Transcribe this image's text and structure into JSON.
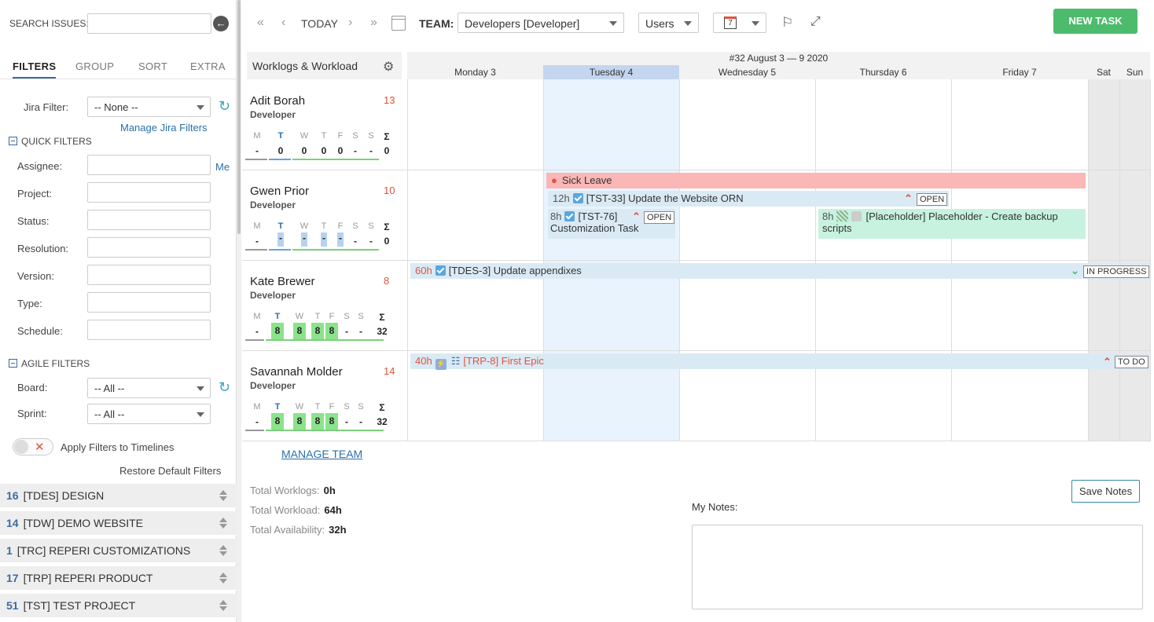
{
  "sidebar": {
    "search_label": "SEARCH ISSUES:",
    "tabs": [
      "FILTERS",
      "GROUP",
      "SORT",
      "EXTRA"
    ],
    "jira_filter_label": "Jira Filter:",
    "jira_filter_value": "-- None --",
    "manage_jira_filters": "Manage Jira Filters",
    "quick_filters_title": "QUICK FILTERS",
    "quick_filters": [
      "Assignee:",
      "Project:",
      "Status:",
      "Resolution:",
      "Version:",
      "Type:",
      "Schedule:"
    ],
    "me_link": "Me",
    "agile_filters_title": "AGILE FILTERS",
    "board_label": "Board:",
    "board_value": "-- All --",
    "sprint_label": "Sprint:",
    "sprint_value": "-- All --",
    "apply_filters_label": "Apply Filters to Timelines",
    "restore_defaults": "Restore Default Filters",
    "projects": [
      {
        "count": "16",
        "name": "[TDES] DESIGN"
      },
      {
        "count": "14",
        "name": "[TDW] DEMO WEBSITE"
      },
      {
        "count": "1",
        "name": "[TRC] REPERI CUSTOMIZATIONS"
      },
      {
        "count": "17",
        "name": "[TRP] REPERI PRODUCT"
      },
      {
        "count": "51",
        "name": "[TST] TEST PROJECT"
      }
    ]
  },
  "toolbar": {
    "today": "TODAY",
    "team_label": "TEAM:",
    "team_value": "Developers [Developer]",
    "users_value": "Users",
    "calendar_day": "7",
    "new_task": "NEW TASK"
  },
  "grid": {
    "panel_title": "Worklogs & Workload",
    "week_title": "#32 August 3 — 9 2020",
    "days": [
      "Monday 3",
      "Tuesday 4",
      "Wednesday 5",
      "Thursday 6",
      "Friday 7",
      "Sat",
      "Sun"
    ],
    "week_letters": [
      "M",
      "T",
      "W",
      "T",
      "F",
      "S",
      "S",
      "Σ"
    ],
    "users": [
      {
        "name": "Adit Borah",
        "role": "Developer",
        "count": "13",
        "values": [
          "-",
          "0",
          "0",
          "0",
          "0",
          "-",
          "-",
          "0"
        ]
      },
      {
        "name": "Gwen Prior",
        "role": "Developer",
        "count": "10",
        "values": [
          "-",
          "-",
          "-",
          "-",
          "-",
          "-",
          "-",
          "0"
        ]
      },
      {
        "name": "Kate Brewer",
        "role": "Developer",
        "count": "8",
        "values": [
          "-",
          "8",
          "8",
          "8",
          "8",
          "-",
          "-",
          "32"
        ]
      },
      {
        "name": "Savannah Molder",
        "role": "Developer",
        "count": "14",
        "values": [
          "-",
          "8",
          "8",
          "8",
          "8",
          "-",
          "-",
          "32"
        ]
      }
    ],
    "tasks": {
      "sick_leave": "Sick Leave",
      "t1_hours": "12h",
      "t1_title": "[TST-33] Update the Website ORN",
      "t1_status": "OPEN",
      "t2_hours": "8h",
      "t2_title": "[TST-76]",
      "t2_sub": "Customization Task",
      "t2_status": "OPEN",
      "t3_hours": "8h",
      "t3_title": "[Placeholder] Placeholder - Create backup",
      "t3_sub": "scripts",
      "t4_hours": "60h",
      "t4_title": "[TDES-3] Update appendixes",
      "t4_status": "IN PROGRESS",
      "t5_hours": "40h",
      "t5_title": "[TRP-8] First Epic",
      "t5_status": "TO DO"
    },
    "manage_team": "MANAGE TEAM"
  },
  "totals": {
    "worklogs_label": "Total Worklogs:",
    "worklogs_value": "0h",
    "workload_label": "Total Workload:",
    "workload_value": "64h",
    "availability_label": "Total Availability:",
    "availability_value": "32h"
  },
  "notes": {
    "label": "My Notes:",
    "save": "Save Notes"
  }
}
